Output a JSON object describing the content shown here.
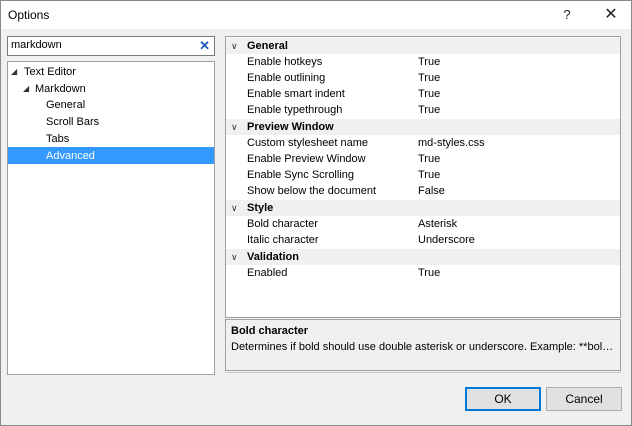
{
  "window": {
    "title": "Options",
    "help_label": "?",
    "close_label": "✕"
  },
  "search": {
    "value": "markdown",
    "clear_label": "✕"
  },
  "tree": {
    "nodes": [
      {
        "label": "Text Editor",
        "arrow": "◢"
      },
      {
        "label": "Markdown",
        "arrow": "◢"
      },
      {
        "label": "General"
      },
      {
        "label": "Scroll Bars"
      },
      {
        "label": "Tabs"
      },
      {
        "label": "Advanced",
        "selected": true
      }
    ]
  },
  "properties": {
    "categories": [
      {
        "name": "General",
        "items": [
          {
            "name": "Enable hotkeys",
            "value": "True"
          },
          {
            "name": "Enable outlining",
            "value": "True"
          },
          {
            "name": "Enable smart indent",
            "value": "True"
          },
          {
            "name": "Enable typethrough",
            "value": "True"
          }
        ]
      },
      {
        "name": "Preview Window",
        "items": [
          {
            "name": "Custom stylesheet name",
            "value": "md-styles.css"
          },
          {
            "name": "Enable Preview Window",
            "value": "True"
          },
          {
            "name": "Enable Sync Scrolling",
            "value": "True"
          },
          {
            "name": "Show below the document",
            "value": "False"
          }
        ]
      },
      {
        "name": "Style",
        "items": [
          {
            "name": "Bold character",
            "value": "Asterisk"
          },
          {
            "name": "Italic character",
            "value": "Underscore"
          }
        ]
      },
      {
        "name": "Validation",
        "items": [
          {
            "name": "Enabled",
            "value": "True"
          }
        ]
      }
    ],
    "collapse_glyph": "∨"
  },
  "description": {
    "title": "Bold character",
    "text": "Determines if bold should use double asterisk or underscore. Example: **bold t..."
  },
  "buttons": {
    "ok": "OK",
    "cancel": "Cancel"
  },
  "colors": {
    "selection": "#3399ff",
    "ok_border": "#0078d7"
  }
}
